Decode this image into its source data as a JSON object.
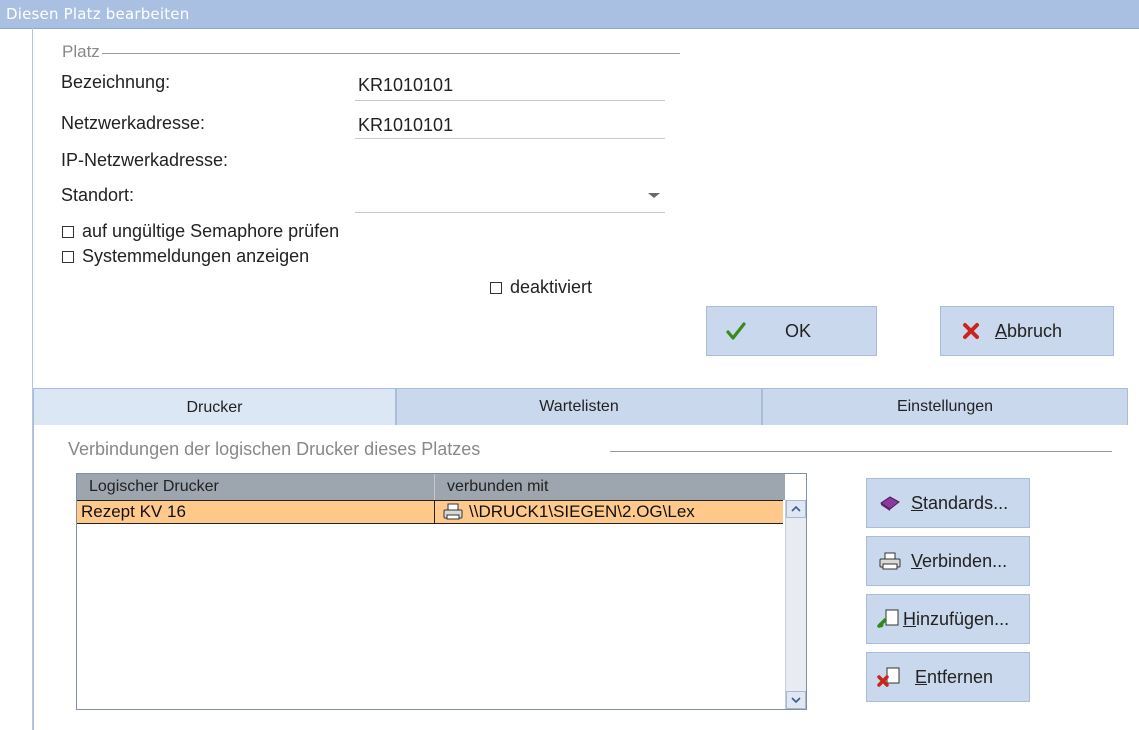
{
  "window": {
    "title": "Diesen Platz bearbeiten"
  },
  "platz_group": {
    "title": "Platz",
    "fields": {
      "bezeichnung": {
        "label": "Bezeichnung:",
        "value": "KR1010101"
      },
      "netzwerkadresse": {
        "label": "Netzwerkadresse:",
        "value": "KR1010101"
      },
      "ip_netzwerkadresse": {
        "label": "IP-Netzwerkadresse:",
        "value": ""
      },
      "standort": {
        "label": "Standort:",
        "value": ""
      }
    },
    "checkboxes": {
      "semaphore": {
        "label": "auf ungültige Semaphore prüfen",
        "checked": false
      },
      "systemmeldungen": {
        "label": "Systemmeldungen anzeigen",
        "checked": false
      },
      "deaktiviert": {
        "label": "deaktiviert",
        "checked": false
      }
    }
  },
  "buttons": {
    "ok": {
      "label": "OK",
      "icon": "checkmark-icon"
    },
    "abbruch": {
      "label_accel": "A",
      "label_rest": "bbruch",
      "icon": "cross-icon"
    }
  },
  "tabs": [
    {
      "label": "Drucker",
      "active": true
    },
    {
      "label": "Wartelisten",
      "active": false
    },
    {
      "label": "Einstellungen",
      "active": false
    }
  ],
  "drucker_tab": {
    "group_title": "Verbindungen der logischen Drucker dieses Platzes",
    "table": {
      "columns": [
        "Logischer Drucker",
        "verbunden mit"
      ],
      "rows": [
        {
          "logischer_drucker": "Rezept KV 16",
          "verbunden_mit": "\\\\DRUCK1\\SIEGEN\\2.OG\\Lex",
          "selected": true
        }
      ]
    },
    "side_buttons": [
      {
        "accel": "S",
        "rest": "tandards...",
        "icon": "book-icon"
      },
      {
        "accel": "V",
        "rest": "erbinden...",
        "icon": "printer-icon"
      },
      {
        "accel": "H",
        "rest": "inzufügen...",
        "icon": "add-document-icon"
      },
      {
        "accel": "E",
        "rest": "ntfernen",
        "icon": "remove-document-icon"
      }
    ]
  },
  "colors": {
    "title_bar": "#a9c0e2",
    "button_bg": "#c9d8ec",
    "selected_row": "#ffc98c",
    "table_header": "#9da5af"
  }
}
